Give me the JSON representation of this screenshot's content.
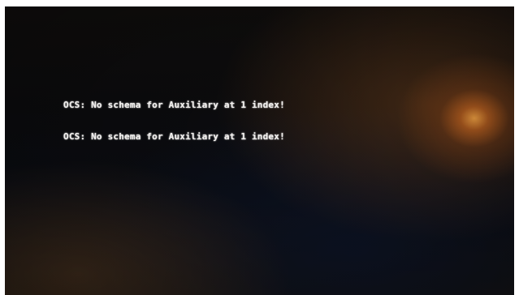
{
  "console": {
    "lines": [
      "OCS: No schema for Auxiliary at 1 index!",
      "OCS: No schema for Auxiliary at 1 index!"
    ]
  }
}
